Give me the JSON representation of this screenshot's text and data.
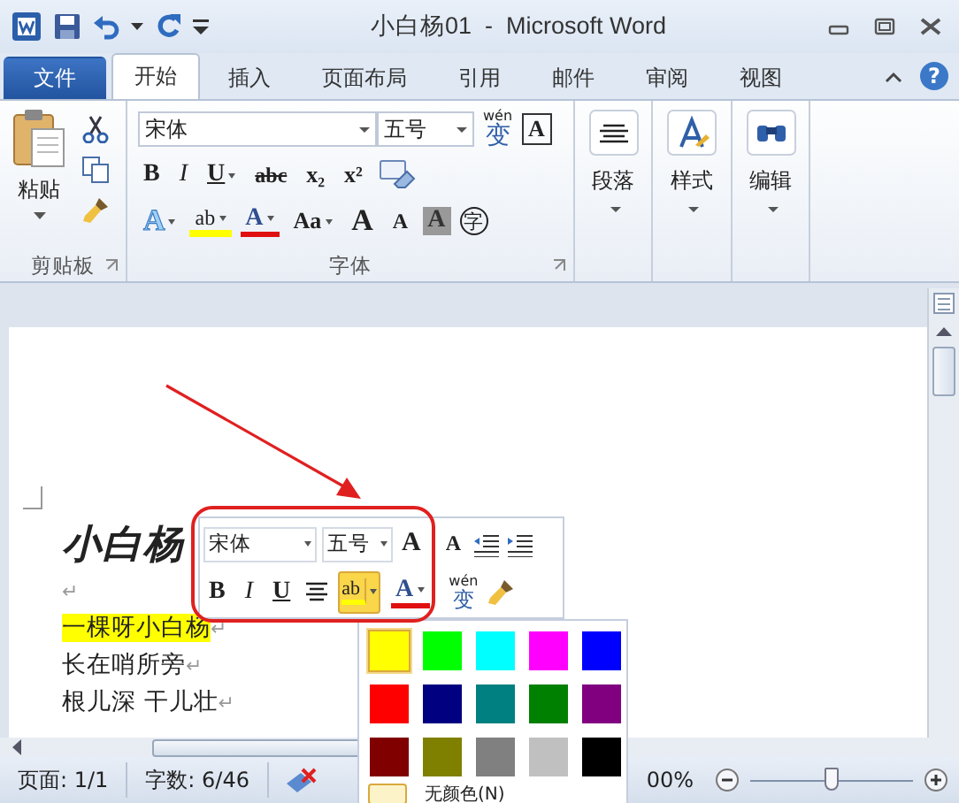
{
  "window": {
    "title": "小白杨01  -  Microsoft Word"
  },
  "tabs": [
    {
      "label": "文件",
      "kind": "file",
      "selected": false
    },
    {
      "label": "开始",
      "kind": "tab",
      "selected": true
    },
    {
      "label": "插入",
      "kind": "tab",
      "selected": false
    },
    {
      "label": "页面布局",
      "kind": "tab",
      "selected": false
    },
    {
      "label": "引用",
      "kind": "tab",
      "selected": false
    },
    {
      "label": "邮件",
      "kind": "tab",
      "selected": false
    },
    {
      "label": "审阅",
      "kind": "tab",
      "selected": false
    },
    {
      "label": "视图",
      "kind": "tab",
      "selected": false
    }
  ],
  "help": "?",
  "ribbon": {
    "clipboard": {
      "paste_label": "粘贴",
      "group_label": "剪贴板"
    },
    "font": {
      "font_name": "宋体",
      "font_size": "五号",
      "phonetic": {
        "ruby": "wén",
        "base": "变"
      },
      "border_glyph": "A",
      "row_2": [
        {
          "glyph": "B",
          "kind": "bold"
        },
        {
          "glyph": "I",
          "kind": "italic"
        },
        {
          "glyph": "U",
          "kind": "underline",
          "dropdown": true
        },
        {
          "glyph": "abc",
          "kind": "strike"
        },
        {
          "glyph": "x₂",
          "kind": "plain"
        },
        {
          "glyph": "x²",
          "kind": "plain"
        }
      ],
      "row_3": [
        {
          "glyph": "A",
          "kind": "effect",
          "dropdown": true
        },
        {
          "glyph": "ab",
          "kind": "highlight",
          "dropdown": true
        },
        {
          "glyph": "A",
          "kind": "color",
          "dropdown": true
        },
        {
          "glyph": "Aa",
          "kind": "plain",
          "dropdown": true
        },
        {
          "glyph": "A",
          "kind": "grow"
        },
        {
          "glyph": "A",
          "kind": "shrink"
        },
        {
          "glyph": "A",
          "kind": "shaded"
        },
        {
          "glyph": "字",
          "kind": "circled"
        }
      ],
      "group_label": "字体"
    },
    "paragraph_label": "段落",
    "styles_label": "样式",
    "editing_label": "编辑"
  },
  "document": {
    "title": "小白杨",
    "lines": [
      {
        "mark": "↵"
      },
      {
        "text": "一棵呀小白杨",
        "mark": "↵",
        "highlighted": true
      },
      {
        "text": "长在哨所旁",
        "mark": "↵",
        "highlighted": false
      },
      {
        "text": "根儿深 干儿壮",
        "mark": "↵",
        "highlighted": false
      }
    ]
  },
  "mini_toolbar": {
    "font_name": "宋体",
    "font_size": "五号",
    "grow_glyph": "A",
    "shrink_glyph": "A",
    "row_2": [
      {
        "glyph": "B",
        "kind": "bold"
      },
      {
        "glyph": "I",
        "kind": "italic"
      },
      {
        "glyph": "U",
        "kind": "underline"
      }
    ],
    "highlight": {
      "glyph": "ab",
      "selected": true
    },
    "color_glyph": "A",
    "phonetic": {
      "ruby": "wén",
      "base": "变"
    }
  },
  "palette": {
    "colors": [
      {
        "color": "#ffff00",
        "selected": true
      },
      {
        "color": "#00ff00",
        "selected": false
      },
      {
        "color": "#00ffff",
        "selected": false
      },
      {
        "color": "#ff00ff",
        "selected": false
      },
      {
        "color": "#0000ff",
        "selected": false
      },
      {
        "color": "#ff0000",
        "selected": false
      },
      {
        "color": "#000080",
        "selected": false
      },
      {
        "color": "#008080",
        "selected": false
      },
      {
        "color": "#008000",
        "selected": false
      },
      {
        "color": "#800080",
        "selected": false
      },
      {
        "color": "#800000",
        "selected": false
      },
      {
        "color": "#808000",
        "selected": false
      },
      {
        "color": "#808080",
        "selected": false
      },
      {
        "color": "#c0c0c0",
        "selected": false
      },
      {
        "color": "#000000",
        "selected": false
      }
    ],
    "no_color_label": "无颜色(N)"
  },
  "status_bar": {
    "page": "页面: 1/1",
    "words": "字数: 6/46",
    "zoom_reading": "00%",
    "level": 0.5
  }
}
